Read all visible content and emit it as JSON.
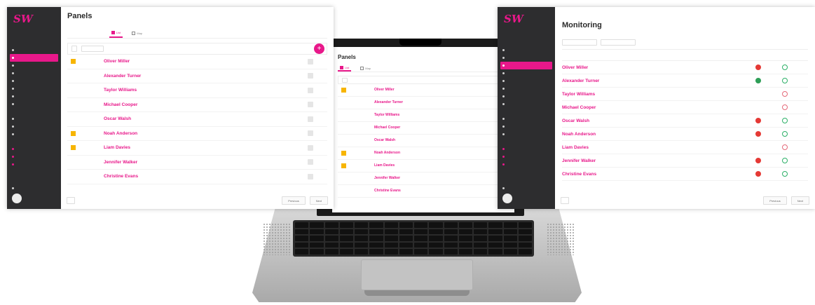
{
  "colors": {
    "accent": "#e8188a",
    "sidebar_bg": "#2d2d2f",
    "flag": "#f7b500",
    "ok": "#2cb067",
    "error": "#e53935"
  },
  "brand": {
    "logo": "SW"
  },
  "panels_window": {
    "title": "Panels",
    "tabs": [
      {
        "label": "List",
        "active": true
      },
      {
        "label": "Map",
        "active": false
      }
    ],
    "rows": [
      {
        "name": "Oliver Miller",
        "flag": true
      },
      {
        "name": "Alexander Turner",
        "flag": false
      },
      {
        "name": "Taylor Williams",
        "flag": false
      },
      {
        "name": "Michael Cooper",
        "flag": false
      },
      {
        "name": "Oscar Walsh",
        "flag": false
      },
      {
        "name": "Noah Anderson",
        "flag": true
      },
      {
        "name": "Liam Davies",
        "flag": true
      },
      {
        "name": "Jennifer Walker",
        "flag": false
      },
      {
        "name": "Christine Evans",
        "flag": false
      }
    ],
    "footer": {
      "previous": "Previous",
      "next": "Next"
    }
  },
  "laptop_window": {
    "title": "Panels",
    "tabs": [
      {
        "label": "List",
        "active": true
      },
      {
        "label": "Map",
        "active": false
      }
    ],
    "rows": [
      {
        "name": "Oliver Miller",
        "flag": true
      },
      {
        "name": "Alexander Turner",
        "flag": false
      },
      {
        "name": "Taylor Williams",
        "flag": false
      },
      {
        "name": "Michael Cooper",
        "flag": false
      },
      {
        "name": "Oscar Walsh",
        "flag": false
      },
      {
        "name": "Noah Anderson",
        "flag": true
      },
      {
        "name": "Liam Davies",
        "flag": true
      },
      {
        "name": "Jennifer Walker",
        "flag": false
      },
      {
        "name": "Christine Evans",
        "flag": false
      }
    ]
  },
  "monitoring_window": {
    "title": "Monitoring",
    "rows": [
      {
        "name": "Oliver Miller",
        "s1": "red",
        "s2": "ok"
      },
      {
        "name": "Alexander Turner",
        "s1": "green",
        "s2": "ok"
      },
      {
        "name": "Taylor Williams",
        "s1": "",
        "s2": "no"
      },
      {
        "name": "Michael Cooper",
        "s1": "",
        "s2": "no"
      },
      {
        "name": "Oscar Walsh",
        "s1": "red",
        "s2": "ok"
      },
      {
        "name": "Noah Anderson",
        "s1": "red",
        "s2": "ok"
      },
      {
        "name": "Liam Davies",
        "s1": "",
        "s2": "no"
      },
      {
        "name": "Jennifer Walker",
        "s1": "red",
        "s2": "ok"
      },
      {
        "name": "Christine Evans",
        "s1": "red",
        "s2": "ok"
      }
    ],
    "footer": {
      "previous": "Previous",
      "next": "Next"
    }
  }
}
